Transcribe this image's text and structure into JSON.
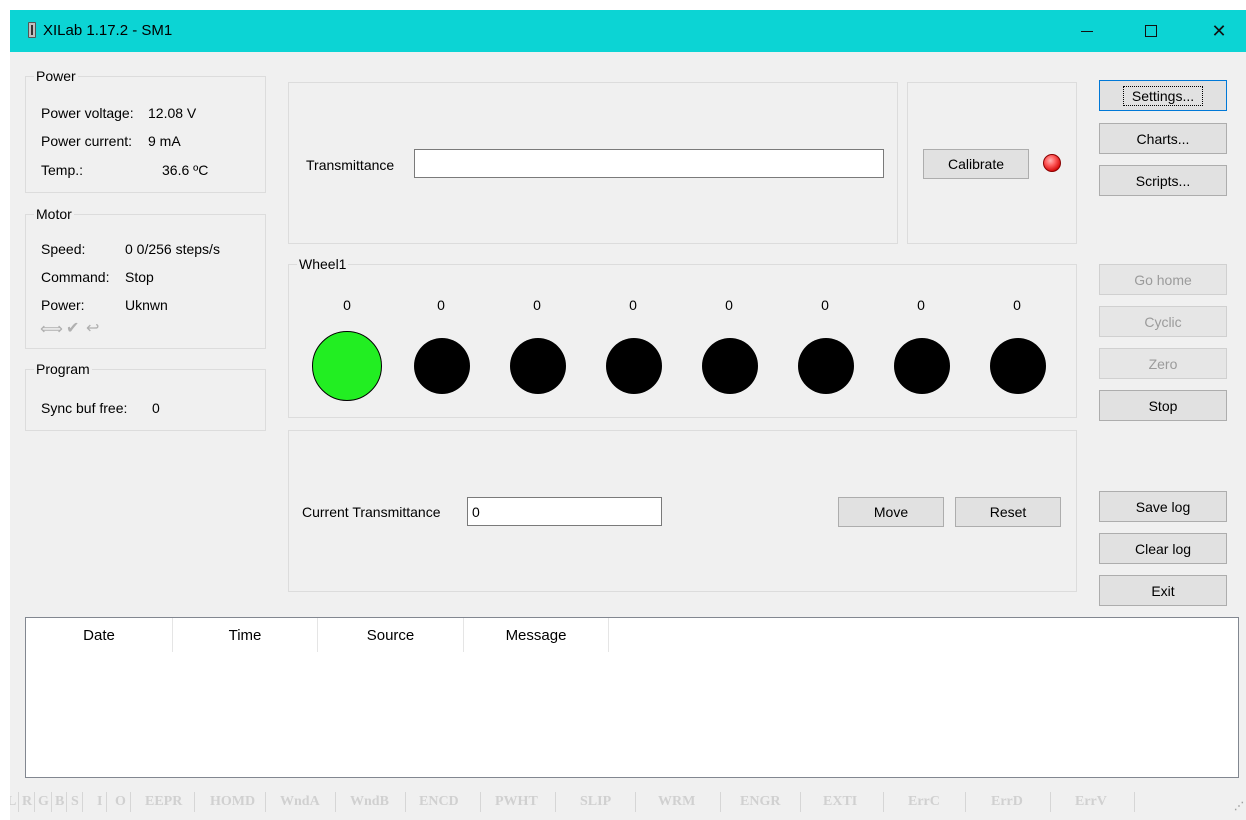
{
  "window": {
    "title": "XILab 1.17.2 - SM1",
    "close_glyph": "✕",
    "icons": [
      "app-icon",
      "minimize-icon",
      "maximize-icon",
      "close-icon"
    ],
    "accent_color": "#0cd4d4"
  },
  "power": {
    "legend": "Power",
    "voltage_label": "Power voltage:",
    "voltage_value": "12.08 V",
    "current_label": "Power current:",
    "current_value": "9 mA",
    "temp_label": "Temp.:",
    "temp_value": "36.6 ºC"
  },
  "motor": {
    "legend": "Motor",
    "speed_label": "Speed:",
    "speed_value": "0 0/256 steps/s",
    "command_label": "Command:",
    "command_value": "Stop",
    "power_label": "Power:",
    "power_value": "Uknwn",
    "status_icons": [
      "arrows-icon",
      "check-icon",
      "undo-icon"
    ]
  },
  "program": {
    "legend": "Program",
    "sync_label": "Sync buf free:",
    "sync_value": "0"
  },
  "transmittance": {
    "label": "Transmittance",
    "value": ""
  },
  "calibrate": {
    "button": "Calibrate",
    "led_color": "#ff3b3b"
  },
  "wheel": {
    "legend": "Wheel1",
    "counts": [
      "0",
      "0",
      "0",
      "0",
      "0",
      "0",
      "0",
      "0"
    ],
    "active_index": 0,
    "active_color": "#22ee22",
    "inactive_color": "#000000"
  },
  "current": {
    "label": "Current Transmittance",
    "value": "0",
    "move_button": "Move",
    "reset_button": "Reset"
  },
  "sidebar": {
    "settings": "Settings...",
    "charts": "Charts...",
    "scripts": "Scripts...",
    "go_home": "Go home",
    "cyclic": "Cyclic",
    "zero": "Zero",
    "stop": "Stop",
    "save_log": "Save log",
    "clear_log": "Clear log",
    "exit": "Exit"
  },
  "log": {
    "columns": [
      "Date",
      "Time",
      "Source",
      "Message"
    ]
  },
  "statusbar": {
    "items": [
      "L",
      "R",
      "G",
      "B",
      "S",
      "I",
      "O",
      "EEPR",
      "HOMD",
      "WndA",
      "WndB",
      "ENCD",
      "PWHT",
      "SLIP",
      "WRM",
      "ENGR",
      "EXTI",
      "ErrC",
      "ErrD",
      "ErrV"
    ]
  }
}
